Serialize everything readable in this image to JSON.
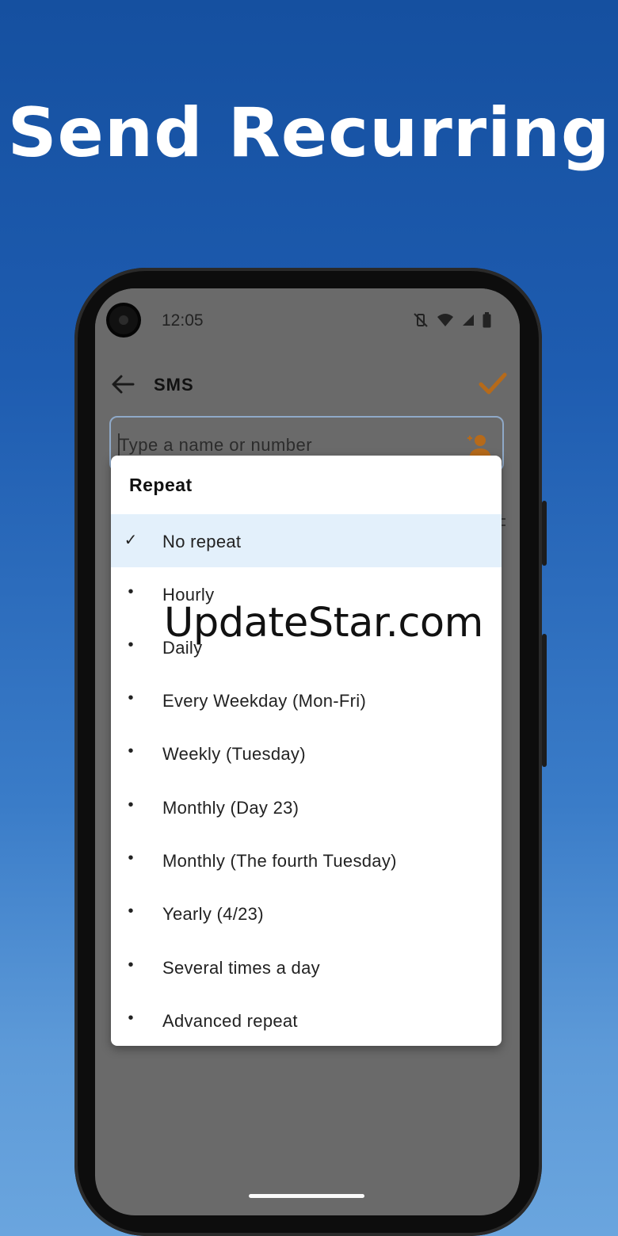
{
  "headline": "Send Recurring",
  "status_bar": {
    "time": "12:05"
  },
  "app_bar": {
    "title": "SMS"
  },
  "recipient": {
    "placeholder": "Type a name or number"
  },
  "dialog": {
    "title": "Repeat",
    "options": [
      {
        "label": "No repeat",
        "marker": "✓",
        "selected": true
      },
      {
        "label": "Hourly",
        "marker": "•"
      },
      {
        "label": "Daily",
        "marker": "•"
      },
      {
        "label": "Every Weekday (Mon-Fri)",
        "marker": "•"
      },
      {
        "label": "Weekly (Tuesday)",
        "marker": "•"
      },
      {
        "label": "Monthly (Day 23)",
        "marker": "•"
      },
      {
        "label": "Monthly (The fourth Tuesday)",
        "marker": "•"
      },
      {
        "label": "Yearly (4/23)",
        "marker": "•"
      },
      {
        "label": "Several times a day",
        "marker": "•"
      },
      {
        "label": "Advanced repeat",
        "marker": "•"
      }
    ]
  },
  "watermark": "UpdateStar.com",
  "colors": {
    "accent": "#e8892a",
    "selected_row": "#e3f0fb"
  }
}
